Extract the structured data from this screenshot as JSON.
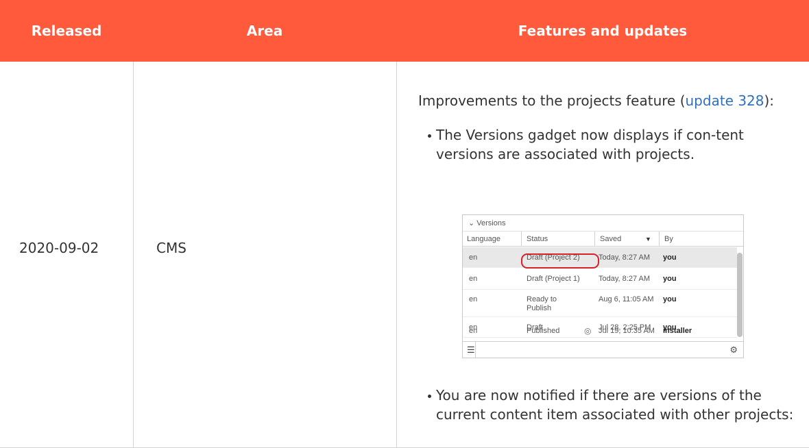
{
  "table": {
    "headers": {
      "released": "Released",
      "area": "Area",
      "features": "Features and updates"
    },
    "row": {
      "released": "2020-09-02",
      "area": "CMS",
      "intro_before": "Improvements to the projects feature (",
      "intro_link": "update 328",
      "intro_after": "):",
      "bullet1": "The Versions gadget now displays if con-tent versions are associated with projects.",
      "bullet2": "You are now notified if there are versions of the current content item associated with other projects:"
    }
  },
  "gadget": {
    "title": "Versions",
    "columns": {
      "language": "Language",
      "status": "Status",
      "saved": "Saved",
      "by": "By"
    },
    "rows": [
      {
        "language": "en",
        "status": "Draft (Project 2)",
        "saved": "Today, 8:27 AM",
        "by": "you"
      },
      {
        "language": "en",
        "status": "Draft (Project 1)",
        "saved": "Today, 8:27 AM",
        "by": "you"
      },
      {
        "language": "en",
        "status": "Ready to Publish",
        "saved": "Aug 6, 11:05 AM",
        "by": "you"
      },
      {
        "language": "en",
        "status": "Draft",
        "saved": "Jul 28, 2:25 PM",
        "by": "you"
      },
      {
        "language": "en",
        "status": "Published",
        "saved": "Jul 19, 10:35 AM",
        "by": "installer"
      }
    ]
  },
  "colors": {
    "header_bg": "#ff5a3c",
    "link": "#2e6fbf",
    "highlight": "#d6202a"
  },
  "icons": {
    "collapse": "chevron-down-icon",
    "sort": "sort-down-icon",
    "published": "published-icon",
    "menu": "menu-icon",
    "settings": "gear-icon"
  }
}
